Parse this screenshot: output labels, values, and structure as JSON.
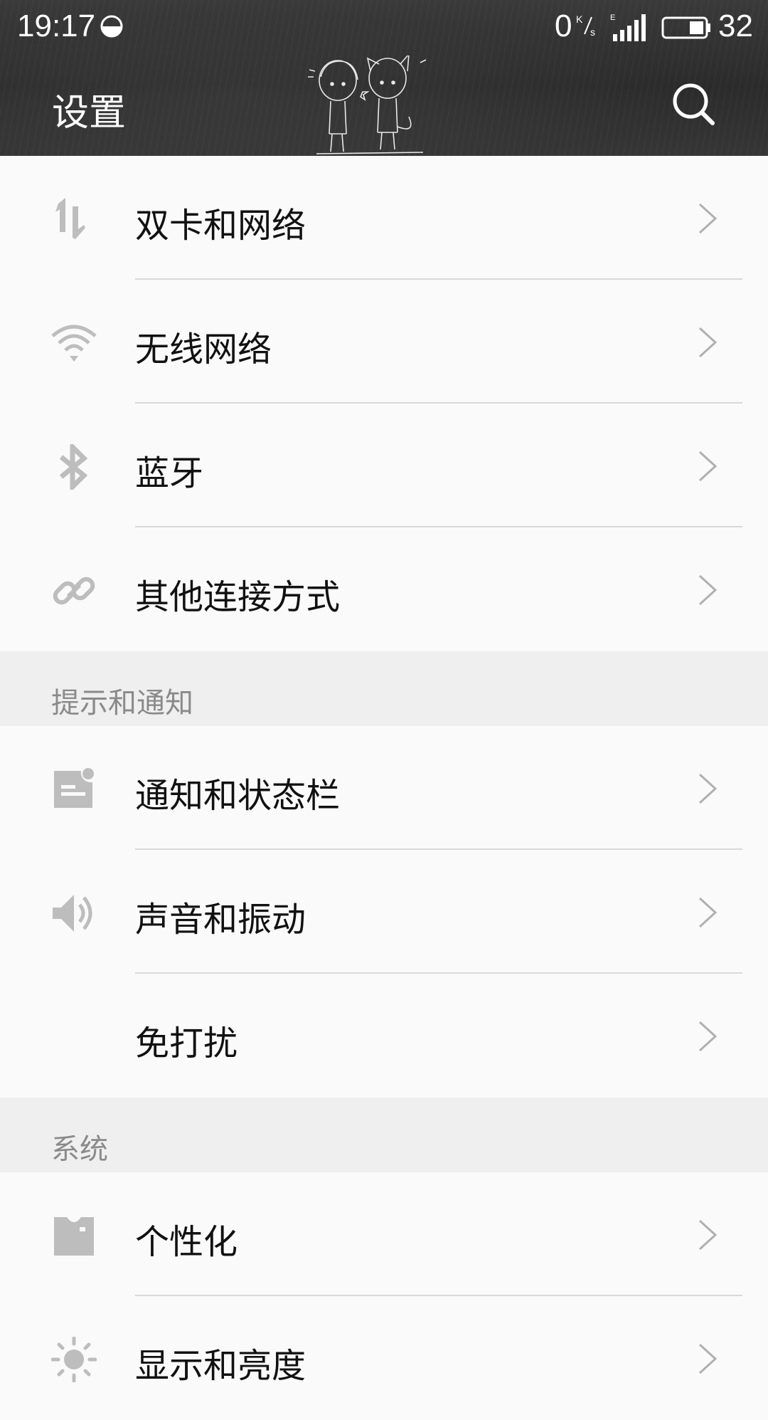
{
  "status_bar": {
    "time": "19:17",
    "net_speed": "0",
    "net_speed_unit": "K/s",
    "battery_level": "32"
  },
  "header": {
    "title": "设置",
    "search_icon": "search-icon"
  },
  "sections": [
    {
      "title": "",
      "items": [
        {
          "label": "双卡和网络",
          "icon": "dual-sim-data-icon"
        },
        {
          "label": "无线网络",
          "icon": "wifi-icon"
        },
        {
          "label": "蓝牙",
          "icon": "bluetooth-icon"
        },
        {
          "label": "其他连接方式",
          "icon": "link-icon"
        }
      ]
    },
    {
      "title": "提示和通知",
      "items": [
        {
          "label": "通知和状态栏",
          "icon": "notification-icon"
        },
        {
          "label": "声音和振动",
          "icon": "speaker-icon"
        },
        {
          "label": "免打扰",
          "icon": "moon-icon"
        }
      ]
    },
    {
      "title": "系统",
      "items": [
        {
          "label": "个性化",
          "icon": "personalization-icon"
        },
        {
          "label": "显示和亮度",
          "icon": "sun-icon"
        }
      ]
    }
  ],
  "colors": {
    "header_bg": "#2e2e2e",
    "list_bg": "#fafafa",
    "section_bg": "#efefef",
    "icon_gray": "#b8b8b8",
    "chevron_gray": "#b0b0b0"
  }
}
